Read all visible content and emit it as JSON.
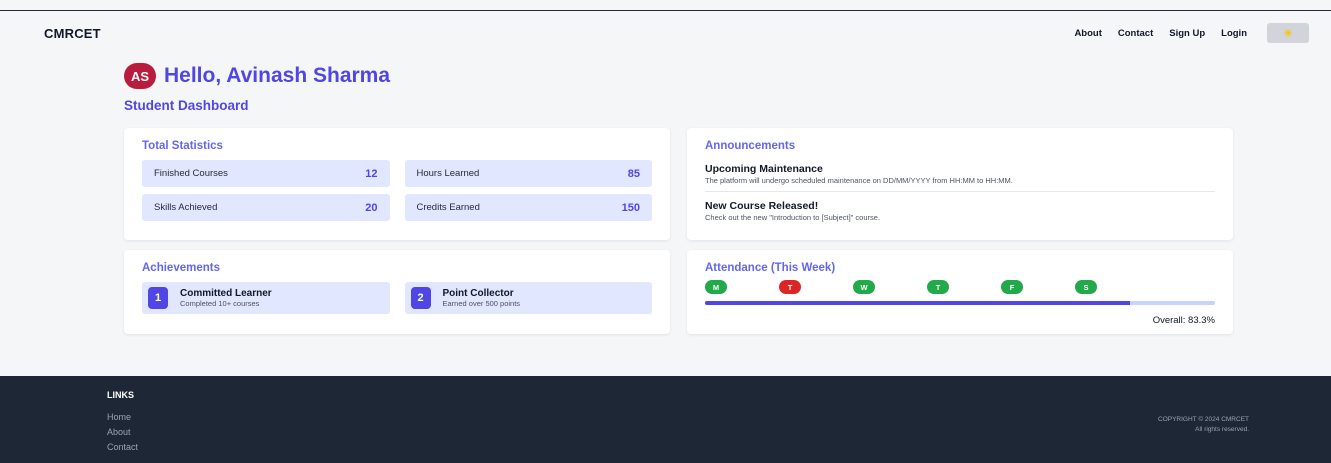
{
  "nav": {
    "brand": "CMRCET",
    "links": [
      "About",
      "Contact",
      "Sign Up",
      "Login"
    ],
    "theme_icon": "sun-icon"
  },
  "greeting": {
    "avatar": "AS",
    "text": "Hello, Avinash Sharma"
  },
  "subtitle": "Student Dashboard",
  "stats": {
    "title": "Total Statistics",
    "items": [
      {
        "label": "Finished Courses",
        "value": "12"
      },
      {
        "label": "Hours Learned",
        "value": "85"
      },
      {
        "label": "Skills Achieved",
        "value": "20"
      },
      {
        "label": "Credits Earned",
        "value": "150"
      }
    ]
  },
  "announcements": {
    "title": "Announcements",
    "items": [
      {
        "title": "Upcoming Maintenance",
        "body": "The platform will undergo scheduled maintenance on DD/MM/YYYY from HH:MM to HH:MM."
      },
      {
        "title": "New Course Released!",
        "body": "Check out the new \"Introduction to [Subject]\" course."
      }
    ]
  },
  "achievements": {
    "title": "Achievements",
    "items": [
      {
        "num": "1",
        "title": "Committed Learner",
        "desc": "Completed 10+ courses"
      },
      {
        "num": "2",
        "title": "Point Collector",
        "desc": "Earned over 500 points"
      }
    ]
  },
  "attendance": {
    "title": "Attendance (This Week)",
    "days": [
      {
        "label": "M",
        "status": "present"
      },
      {
        "label": "T",
        "status": "absent"
      },
      {
        "label": "W",
        "status": "present"
      },
      {
        "label": "T",
        "status": "present"
      },
      {
        "label": "F",
        "status": "present"
      },
      {
        "label": "S",
        "status": "present"
      }
    ],
    "progress_percent": 83.3,
    "overall": "Overall: 83.3%"
  },
  "footer": {
    "heading": "LINKS",
    "links": [
      "Home",
      "About",
      "Contact"
    ],
    "copyright": "COPYRIGHT © 2024 CMRCET",
    "rights": "All rights reserved."
  },
  "colors": {
    "accent": "#4f46e5",
    "present": "#22a94a",
    "absent": "#dc2626",
    "footer_bg": "#1e2736"
  }
}
